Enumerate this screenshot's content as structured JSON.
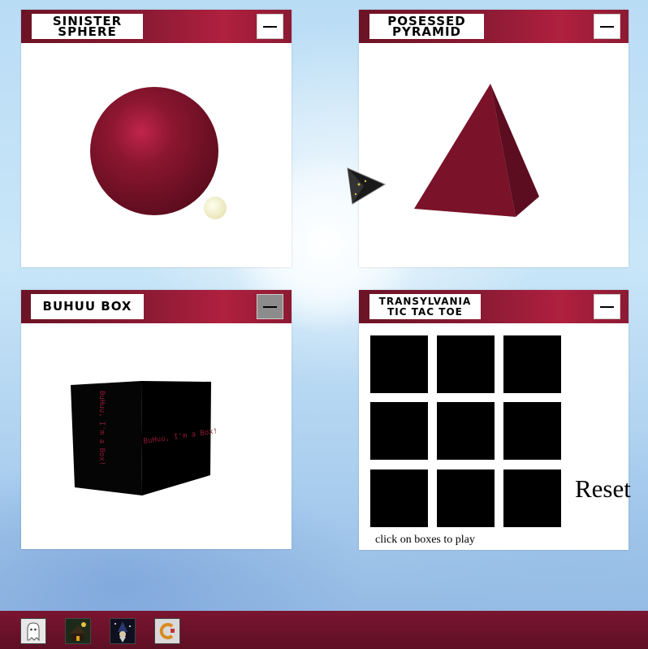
{
  "windows": {
    "sphere": {
      "title": "SINISTER SPHERE"
    },
    "pyramid": {
      "title_line1": "POSESSED",
      "title_line2": "PYRAMID"
    },
    "box": {
      "title": "BUHUU BOX",
      "face_text_front": "BuHuu, I'm a Box!",
      "face_text_side": "BuHuu, I'm a Box!"
    },
    "tictactoe": {
      "title_line1": "TRANSYLVANIA",
      "title_line2": "TIC TAC TOE",
      "reset_label": "Reset",
      "hint": "click on boxes to play"
    }
  },
  "taskbar": {
    "icons": [
      "ghost-icon",
      "haunted-house-icon",
      "wizard-icon",
      "c-logo-icon"
    ]
  },
  "colors": {
    "titlebar": "#8a1a33",
    "object": "#7d1329",
    "taskbar": "#6a1229"
  }
}
